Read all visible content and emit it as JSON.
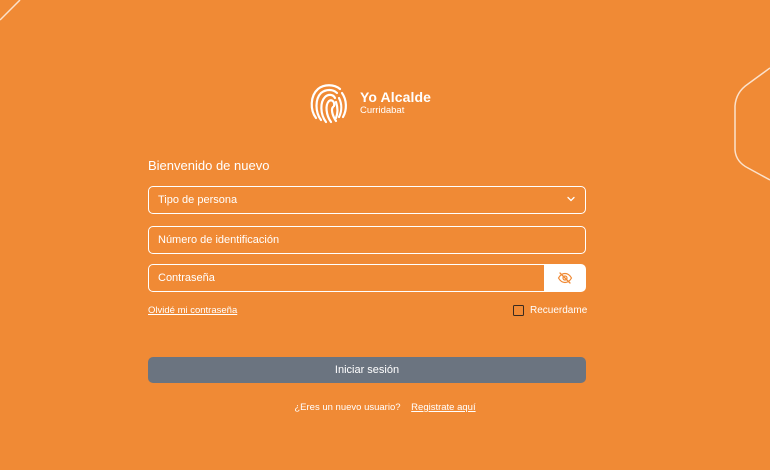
{
  "brand": {
    "title": "Yo Alcalde",
    "subtitle": "Curridabat"
  },
  "login": {
    "welcome": "Bienvenido de nuevo",
    "person_type_placeholder": "Tipo de persona",
    "id_number_placeholder": "Número de identificación",
    "password_placeholder": "Contraseña",
    "forgot_password": "Olvidé mi contraseña",
    "remember_me": "Recuerdame",
    "submit_label": "Iniciar sesión",
    "new_user_prompt": "¿Eres un nuevo usuario?",
    "register_link": "Registrate aquí"
  },
  "colors": {
    "background": "#F08A35",
    "button": "#6B7480",
    "text": "#FFFFFF"
  },
  "icons": {
    "select": "chevron-down-icon",
    "password_toggle": "eye-slash-icon",
    "logo": "fingerprint-logo-icon"
  }
}
